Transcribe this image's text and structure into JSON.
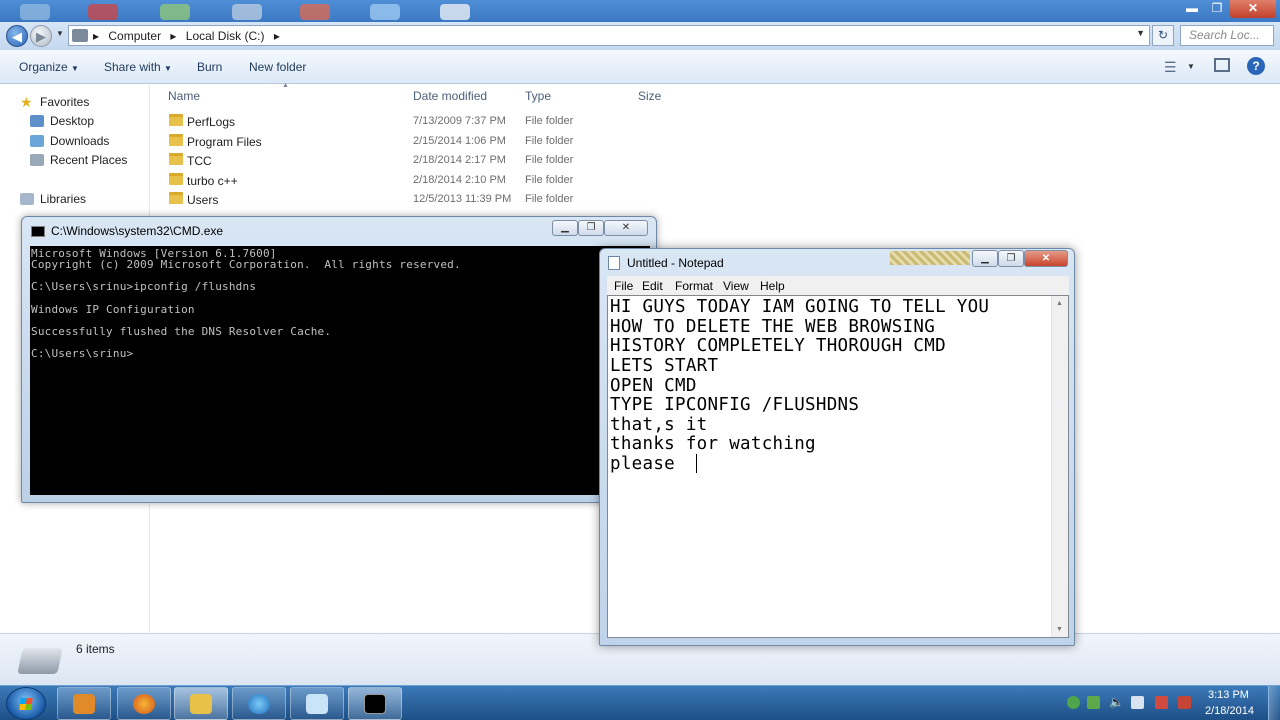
{
  "explorer": {
    "address": {
      "crumbs": [
        "Computer",
        "Local Disk (C:)"
      ]
    },
    "search": {
      "placeholder": "Search Loc..."
    },
    "toolbar": {
      "organize": "Organize",
      "share_with": "Share with",
      "burn": "Burn",
      "new_folder": "New folder"
    },
    "nav": {
      "favorites": "Favorites",
      "desktop": "Desktop",
      "downloads": "Downloads",
      "recent_places": "Recent Places",
      "libraries": "Libraries"
    },
    "columns": {
      "name": "Name",
      "date_modified": "Date modified",
      "type": "Type",
      "size": "Size"
    },
    "files": [
      {
        "name": "PerfLogs",
        "date": "7/13/2009 7:37 PM",
        "type": "File folder"
      },
      {
        "name": "Program Files",
        "date": "2/15/2014 1:06 PM",
        "type": "File folder"
      },
      {
        "name": "TCC",
        "date": "2/18/2014 2:17 PM",
        "type": "File folder"
      },
      {
        "name": "turbo c++",
        "date": "2/18/2014 2:10 PM",
        "type": "File folder"
      },
      {
        "name": "Users",
        "date": "12/5/2013 11:39 PM",
        "type": "File folder"
      }
    ],
    "status": {
      "item_count": "6 items"
    }
  },
  "cmd": {
    "title": "C:\\Windows\\system32\\CMD.exe",
    "lines": [
      "Microsoft Windows [Version 6.1.7600]",
      "Copyright (c) 2009 Microsoft Corporation.  All rights reserved.",
      "",
      "C:\\Users\\srinu>ipconfig /flushdns",
      "",
      "Windows IP Configuration",
      "",
      "Successfully flushed the DNS Resolver Cache.",
      "",
      "C:\\Users\\srinu>"
    ]
  },
  "notepad": {
    "title": "Untitled - Notepad",
    "menu": {
      "file": "File",
      "edit": "Edit",
      "format": "Format",
      "view": "View",
      "help": "Help"
    },
    "lines": [
      "HI GUYS TODAY IAM GOING TO TELL YOU",
      "HOW TO DELETE THE WEB BROWSING",
      "HISTORY COMPLETELY THOROUGH CMD",
      "LETS START",
      "OPEN CMD",
      "TYPE IPCONFIG /FLUSHDNS",
      "that,s it",
      "thanks for watching",
      "please "
    ]
  },
  "taskbar": {
    "clock": {
      "time": "3:13 PM",
      "date": "2/18/2014"
    }
  },
  "icons": {
    "back": "back-arrow-icon",
    "forward": "forward-arrow-icon",
    "help": "help-icon",
    "folder": "folder-icon",
    "start": "windows-start-icon"
  }
}
